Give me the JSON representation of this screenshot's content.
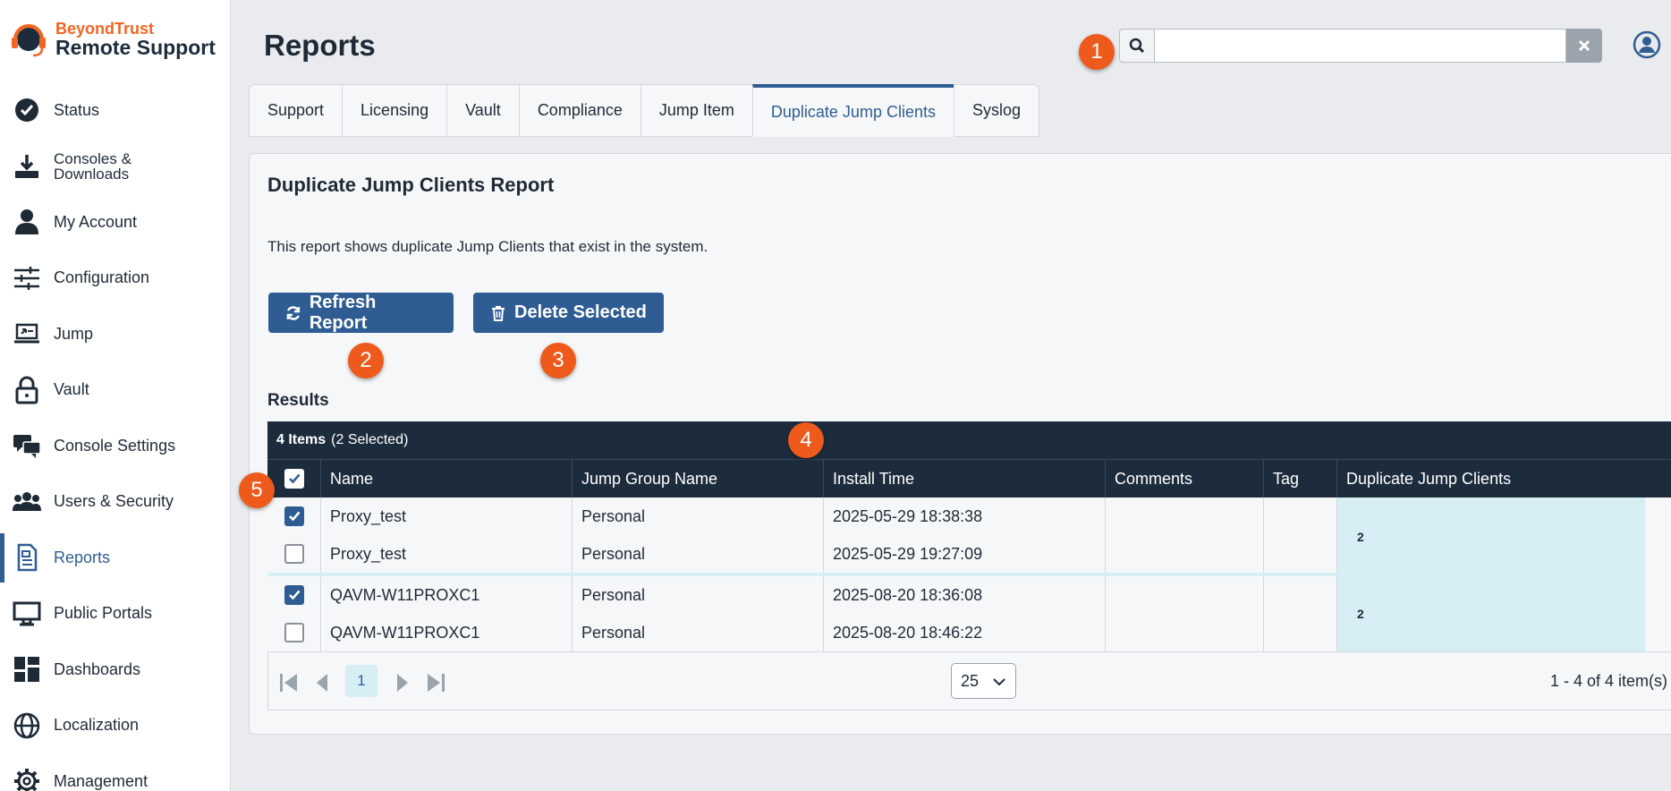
{
  "brand": {
    "top": "BeyondTrust",
    "bottom": "Remote Support"
  },
  "sidebar": {
    "items": [
      {
        "label": "Status",
        "icon": "check-circle-icon"
      },
      {
        "label": "Consoles & Downloads",
        "icon": "download-icon"
      },
      {
        "label": "My Account",
        "icon": "person-icon"
      },
      {
        "label": "Configuration",
        "icon": "sliders-icon"
      },
      {
        "label": "Jump",
        "icon": "jump-laptop-icon"
      },
      {
        "label": "Vault",
        "icon": "lock-icon"
      },
      {
        "label": "Console Settings",
        "icon": "chat-bubbles-icon"
      },
      {
        "label": "Users & Security",
        "icon": "users-icon"
      },
      {
        "label": "Reports",
        "icon": "report-document-icon",
        "active": true
      },
      {
        "label": "Public Portals",
        "icon": "monitor-icon"
      },
      {
        "label": "Dashboards",
        "icon": "dashboard-icon"
      },
      {
        "label": "Localization",
        "icon": "globe-icon"
      },
      {
        "label": "Management",
        "icon": "gear-icon"
      }
    ]
  },
  "header": {
    "title": "Reports",
    "search_value": ""
  },
  "tabs": [
    {
      "label": "Support"
    },
    {
      "label": "Licensing"
    },
    {
      "label": "Vault"
    },
    {
      "label": "Compliance"
    },
    {
      "label": "Jump Item"
    },
    {
      "label": "Duplicate Jump Clients",
      "active": true
    },
    {
      "label": "Syslog"
    }
  ],
  "panel": {
    "title": "Duplicate Jump Clients Report",
    "description": "This report shows duplicate Jump Clients that exist in the system.",
    "refresh_label": "Refresh Report",
    "delete_label": "Delete Selected",
    "results_label": "Results"
  },
  "table": {
    "items_count": "4 Items",
    "selected_count": "(2 Selected)",
    "columns": [
      "Name",
      "Jump Group Name",
      "Install Time",
      "Comments",
      "Tag",
      "Duplicate Jump Clients"
    ],
    "groups": [
      {
        "duplicates": "2",
        "rows": [
          {
            "checked": true,
            "name": "Proxy_test",
            "group": "Personal",
            "install_time": "2025-05-29 18:38:38",
            "comments": "",
            "tag": ""
          },
          {
            "checked": false,
            "name": "Proxy_test",
            "group": "Personal",
            "install_time": "2025-05-29 19:27:09",
            "comments": "",
            "tag": ""
          }
        ]
      },
      {
        "duplicates": "2",
        "rows": [
          {
            "checked": true,
            "name": "QAVM-W11PROXC1",
            "group": "Personal",
            "install_time": "2025-08-20 18:36:08",
            "comments": "",
            "tag": ""
          },
          {
            "checked": false,
            "name": "QAVM-W11PROXC1",
            "group": "Personal",
            "install_time": "2025-08-20 18:46:22",
            "comments": "",
            "tag": ""
          }
        ]
      }
    ]
  },
  "pager": {
    "current_page": "1",
    "page_size": "25",
    "info": "1 - 4 of 4 item(s)"
  },
  "callouts": [
    "1",
    "2",
    "3",
    "4",
    "5"
  ],
  "colors": {
    "accent": "#2f5d93",
    "brand_orange": "#f26522",
    "header_dark": "#1d2c3d",
    "callout": "#ee5a1c",
    "highlight": "#d7eef5"
  }
}
